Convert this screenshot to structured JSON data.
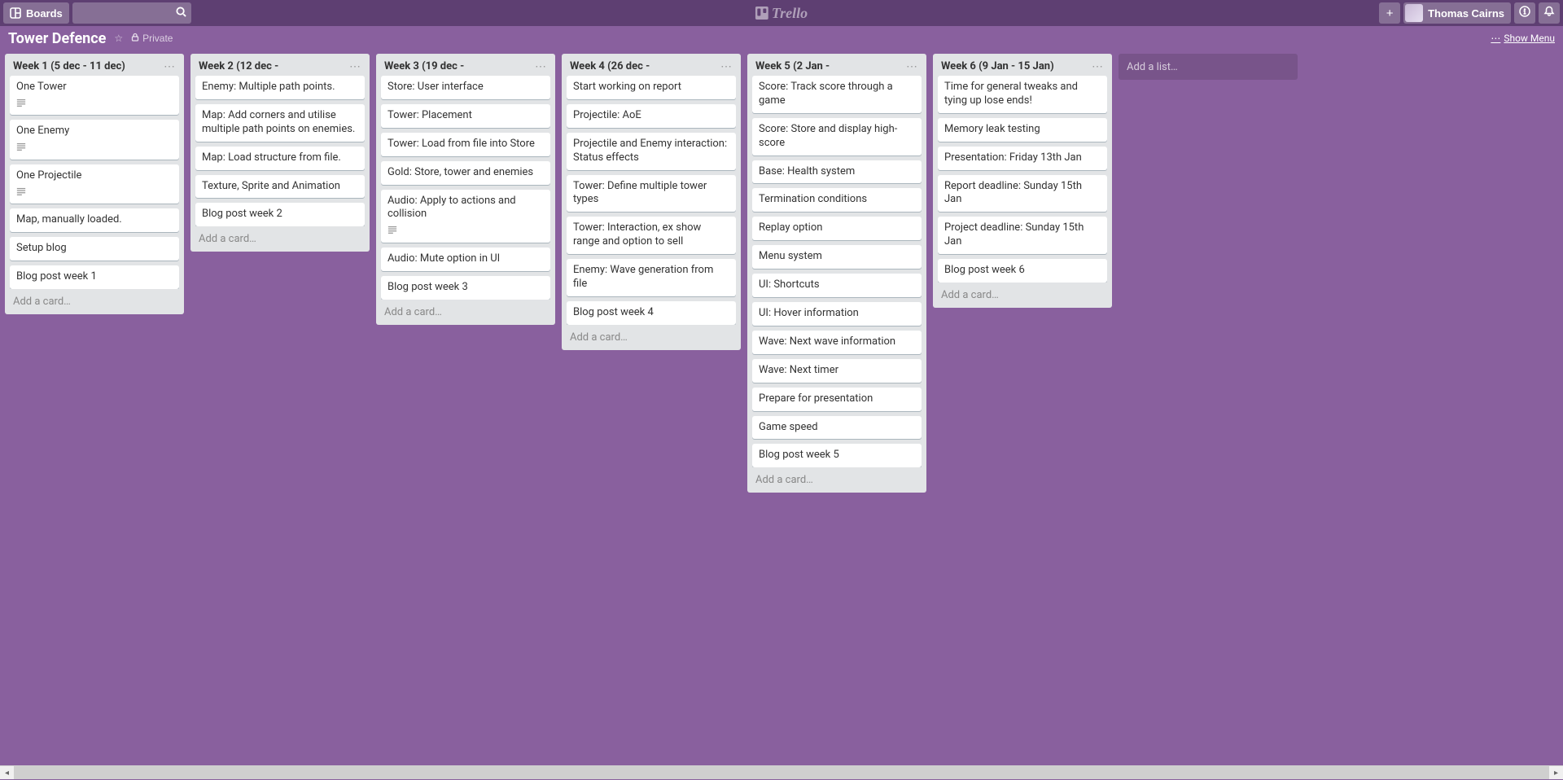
{
  "header": {
    "boards_label": "Boards",
    "search_placeholder": "",
    "logo_text": "Trello",
    "user_name": "Thomas Cairns"
  },
  "board": {
    "title": "Tower Defence",
    "visibility": "Private",
    "show_menu_label": "Show Menu",
    "add_list_placeholder": "Add a list…",
    "add_card_label": "Add a card…"
  },
  "lists": [
    {
      "title": "Week 1 (5 dec - 11 dec)",
      "cards": [
        {
          "text": "One Tower",
          "has_desc": true
        },
        {
          "text": "One Enemy",
          "has_desc": true
        },
        {
          "text": "One Projectile",
          "has_desc": true
        },
        {
          "text": "Map, manually loaded.",
          "has_desc": false
        },
        {
          "text": "Setup blog",
          "has_desc": false
        },
        {
          "text": "Blog post week 1",
          "has_desc": false
        }
      ]
    },
    {
      "title": "Week 2 (12 dec -",
      "cards": [
        {
          "text": "Enemy: Multiple path points.",
          "has_desc": false
        },
        {
          "text": "Map: Add corners and utilise multiple path points on enemies.",
          "has_desc": false
        },
        {
          "text": "Map: Load structure from file.",
          "has_desc": false
        },
        {
          "text": "Texture, Sprite and Animation",
          "has_desc": false
        },
        {
          "text": "Blog post week 2",
          "has_desc": false
        }
      ]
    },
    {
      "title": "Week 3 (19 dec -",
      "cards": [
        {
          "text": "Store: User interface",
          "has_desc": false
        },
        {
          "text": "Tower: Placement",
          "has_desc": false
        },
        {
          "text": "Tower: Load from file into Store",
          "has_desc": false
        },
        {
          "text": "Gold: Store, tower and enemies",
          "has_desc": false
        },
        {
          "text": "Audio: Apply to actions and collision",
          "has_desc": true
        },
        {
          "text": "Audio: Mute option in UI",
          "has_desc": false
        },
        {
          "text": "Blog post week 3",
          "has_desc": false
        }
      ]
    },
    {
      "title": "Week 4 (26 dec -",
      "cards": [
        {
          "text": "Start working on report",
          "has_desc": false
        },
        {
          "text": "Projectile: AoE",
          "has_desc": false
        },
        {
          "text": "Projectile and Enemy interaction: Status effects",
          "has_desc": false
        },
        {
          "text": "Tower: Define multiple tower types",
          "has_desc": false
        },
        {
          "text": "Tower: Interaction, ex show range and option to sell",
          "has_desc": false
        },
        {
          "text": "Enemy: Wave generation from file",
          "has_desc": false
        },
        {
          "text": "Blog post week 4",
          "has_desc": false
        }
      ]
    },
    {
      "title": "Week 5 (2 Jan -",
      "cards": [
        {
          "text": "Score: Track score through a game",
          "has_desc": false
        },
        {
          "text": "Score: Store and display high-score",
          "has_desc": false
        },
        {
          "text": "Base: Health system",
          "has_desc": false
        },
        {
          "text": "Termination conditions",
          "has_desc": false
        },
        {
          "text": "Replay option",
          "has_desc": false
        },
        {
          "text": "Menu system",
          "has_desc": false
        },
        {
          "text": "UI: Shortcuts",
          "has_desc": false
        },
        {
          "text": "UI: Hover information",
          "has_desc": false
        },
        {
          "text": "Wave: Next wave information",
          "has_desc": false
        },
        {
          "text": "Wave: Next timer",
          "has_desc": false
        },
        {
          "text": "Prepare for presentation",
          "has_desc": false
        },
        {
          "text": "Game speed",
          "has_desc": false
        },
        {
          "text": "Blog post week 5",
          "has_desc": false
        }
      ]
    },
    {
      "title": "Week 6 (9 Jan - 15 Jan)",
      "cards": [
        {
          "text": "Time for general tweaks and tying up lose ends!",
          "has_desc": false
        },
        {
          "text": "Memory leak testing",
          "has_desc": false
        },
        {
          "text": "Presentation: Friday 13th Jan",
          "has_desc": false
        },
        {
          "text": "Report deadline: Sunday 15th Jan",
          "has_desc": false
        },
        {
          "text": "Project deadline: Sunday 15th Jan",
          "has_desc": false
        },
        {
          "text": "Blog post week 6",
          "has_desc": false
        }
      ]
    }
  ]
}
